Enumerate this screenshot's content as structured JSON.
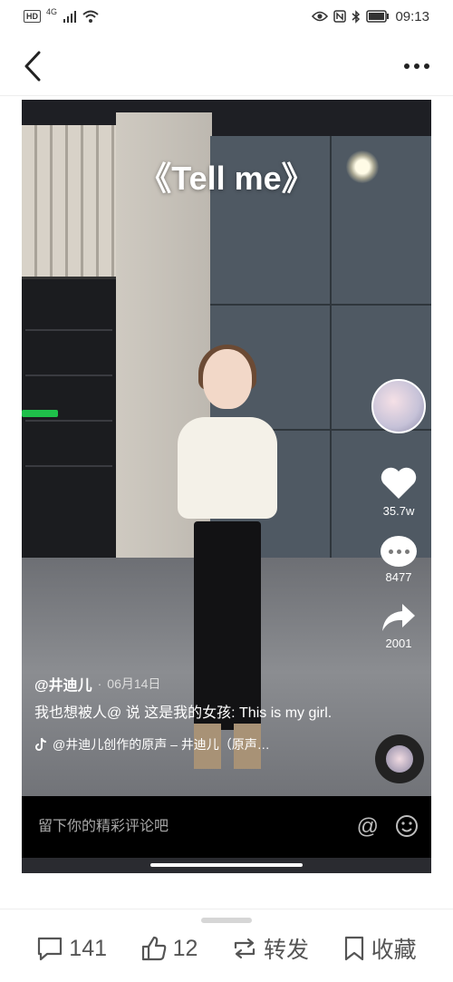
{
  "status_bar": {
    "hd_badge": "HD",
    "network": "4G",
    "time": "09:13",
    "icons": [
      "signal-icon",
      "wifi-icon",
      "eye-icon",
      "nfc-icon",
      "bluetooth-icon",
      "battery-icon"
    ]
  },
  "top_bar": {
    "back_icon": "chevron-left-icon",
    "more_icon": "more-dots-icon"
  },
  "video": {
    "song_title": "《Tell me》",
    "author": "@井迪儿",
    "date_separator": "·",
    "date": "06月14日",
    "description": "我也想被人@ 说 这是我的女孩: This is my girl.",
    "music_icon": "tiktok-note-icon",
    "music": "@井迪儿创作的原声 – 井迪儿（原声…",
    "likes": "35.7w",
    "comments": "8477",
    "shares": "2001",
    "comment_placeholder": "留下你的精彩评论吧",
    "comment_at_icon": "at-icon",
    "comment_emoji_icon": "emoji-icon"
  },
  "bottom_bar": {
    "comment_count": "141",
    "like_count": "12",
    "repost_label": "转发",
    "favorite_label": "收藏"
  },
  "colors": {
    "video_bg": "#2a2b30",
    "comment_bar_bg": "#000000",
    "bottom_text": "#555555"
  }
}
